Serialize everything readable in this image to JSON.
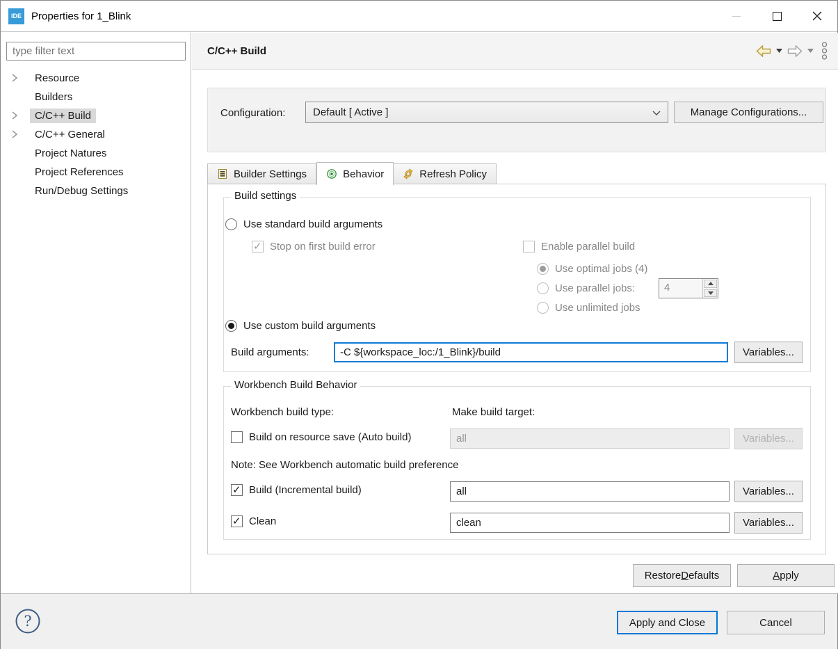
{
  "window": {
    "title": "Properties for 1_Blink",
    "app_icon_label": "IDE"
  },
  "sidebar": {
    "filter_placeholder": "type filter text",
    "items": [
      {
        "label": "Resource",
        "expandable": true,
        "selected": false
      },
      {
        "label": "Builders",
        "expandable": false,
        "selected": false
      },
      {
        "label": "C/C++ Build",
        "expandable": true,
        "selected": true
      },
      {
        "label": "C/C++ General",
        "expandable": true,
        "selected": false
      },
      {
        "label": "Project Natures",
        "expandable": false,
        "selected": false
      },
      {
        "label": "Project References",
        "expandable": false,
        "selected": false
      },
      {
        "label": "Run/Debug Settings",
        "expandable": false,
        "selected": false
      }
    ]
  },
  "header": {
    "title": "C/C++ Build"
  },
  "configuration": {
    "label": "Configuration:",
    "value": "Default  [ Active ]",
    "manage_button": "Manage Configurations..."
  },
  "tabs": {
    "builder_settings": "Builder Settings",
    "behavior": "Behavior",
    "refresh_policy": "Refresh Policy"
  },
  "build_settings": {
    "legend": "Build settings",
    "standard_radio": "Use standard build arguments",
    "stop_on_error": "Stop on first build error",
    "enable_parallel": "Enable parallel build",
    "optimal_jobs": "Use optimal jobs (4)",
    "parallel_jobs": "Use parallel jobs:",
    "parallel_jobs_value": "4",
    "unlimited_jobs": "Use unlimited jobs",
    "custom_radio": "Use custom build arguments",
    "build_args_label": "Build arguments:",
    "build_args_value": "-C ${workspace_loc:/1_Blink}/build",
    "variables_button": "Variables..."
  },
  "workbench": {
    "legend": "Workbench Build Behavior",
    "build_type_label": "Workbench build type:",
    "make_target_label": "Make build target:",
    "auto_build": "Build on resource save (Auto build)",
    "auto_build_target": "all",
    "note": "Note: See Workbench automatic build preference",
    "incremental_build": "Build (Incremental build)",
    "incremental_target": "all",
    "clean": "Clean",
    "clean_target": "clean",
    "variables_button": "Variables..."
  },
  "actions": {
    "restore_defaults_pre": "Restore ",
    "restore_defaults_key": "D",
    "restore_defaults_post": "efaults",
    "apply_key": "A",
    "apply_post": "pply"
  },
  "bottom": {
    "help_glyph": "?",
    "apply_and_close": "Apply and Close",
    "cancel": "Cancel"
  },
  "colors": {
    "accent_blue": "#0078d7",
    "app_icon_blue": "#379bd7",
    "back_arrow_gold": "#b99a3e",
    "behavior_icon_green": "#3f9c46",
    "refresh_icon_gold": "#edc04a",
    "selection_gray": "#d9d9d9"
  },
  "icons": {
    "app": "app-icon",
    "minimize": "minimize-icon",
    "maximize": "maximize-icon",
    "close": "close-icon",
    "tree_chevron": "chevron-right-icon",
    "back": "back-arrow-icon",
    "forward": "forward-arrow-icon",
    "caret": "caret-down-icon",
    "view_menu": "view-menu-icon",
    "combo": "chevron-down-icon",
    "builder_tab": "builder-settings-icon",
    "behavior_tab": "behavior-icon",
    "refresh_tab": "refresh-icon",
    "help": "help-icon"
  }
}
